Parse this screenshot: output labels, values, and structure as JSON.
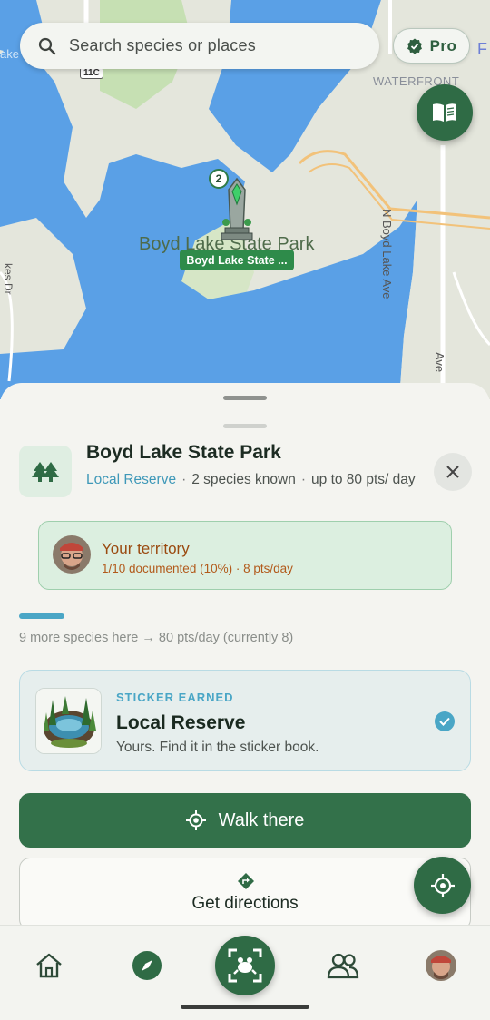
{
  "map": {
    "search_placeholder": "Search species or places",
    "pro_label": "Pro",
    "place_tag": "Boyd Lake State ...",
    "map_place_label": "Boyd Lake State Park",
    "species_count_bubble": "2",
    "street_labels": {
      "waterfront": "WATERFRONT",
      "n_boyd_lake_ave": "N Boyd Lake Ave",
      "ave": "Ave",
      "kes_dr": "kes Dr",
      "route": "11C",
      "ake": "ake",
      "edge_f": "F"
    }
  },
  "sheet": {
    "place_name": "Boyd Lake State Park",
    "place_kind": "Local Reserve",
    "species_known": "2 species known",
    "points_rate": "up to 80 pts/ day",
    "territory": {
      "title": "Your territory",
      "subtitle": "1/10 documented (10%) · 8 pts/day"
    },
    "progress_fraction": 0.1,
    "progress_note": "9 more species here → 80 pts/day (currently 8)",
    "sticker": {
      "eyebrow": "STICKER EARNED",
      "title": "Local Reserve",
      "subtitle": "Yours. Find it in the sticker book."
    },
    "walk_label": "Walk there",
    "directions_label": "Get directions"
  },
  "colors": {
    "brand_green": "#2f6b45",
    "accent_blue": "#4aa6c6",
    "territory_text": "#9a4a10",
    "water": "#5aa0e6",
    "park_green": "#b9dba6"
  },
  "icons": {
    "search": "search-icon",
    "pro": "verified-badge-icon",
    "sticker_book": "open-book-icon",
    "place_type": "pine-trees-icon",
    "close": "close-icon",
    "walk": "location-target-icon",
    "directions": "turn-right-diamond-icon",
    "sticker_check": "check-icon",
    "locate": "crosshair-icon",
    "nav_home": "home-icon",
    "nav_explore": "compass-icon",
    "nav_capture": "frog-scan-icon",
    "nav_friends": "people-icon",
    "nav_profile": "avatar"
  }
}
